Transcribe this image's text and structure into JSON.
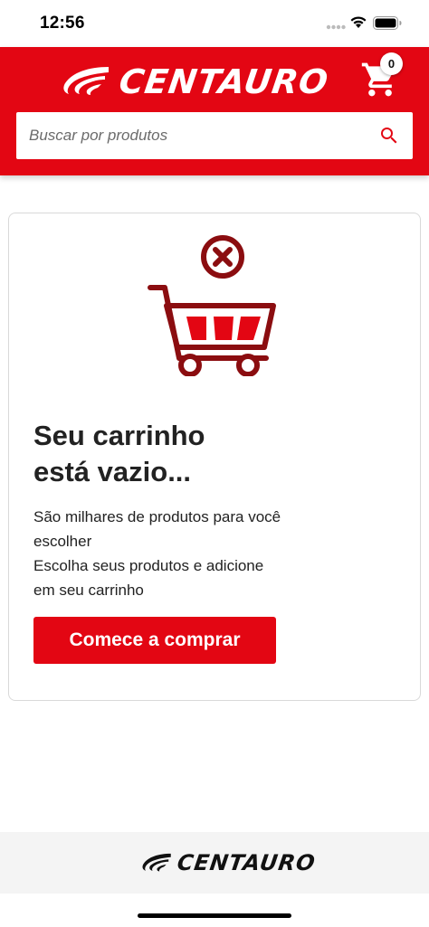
{
  "status_bar": {
    "time": "12:56",
    "icons": [
      "signal-dots-icon",
      "wifi-icon",
      "battery-icon"
    ]
  },
  "header": {
    "brand": "CENTAURO",
    "logo_icon": "centauro-swoosh-icon",
    "cart_icon": "shopping-cart-icon",
    "cart_count": "0",
    "accent_color": "#e30613"
  },
  "search": {
    "placeholder": "Buscar por produtos",
    "value": "",
    "icon": "search-icon"
  },
  "empty_cart": {
    "illustration_icon": "empty-cart-remove-icon",
    "title_line1": "Seu carrinho",
    "title_line2": "está vazio...",
    "message_line1": "São milhares de produtos para você",
    "message_line2": "escolher",
    "message_line3": "Escolha seus produtos e adicione",
    "message_line4": "em seu carrinho",
    "button_label": "Comece a comprar"
  },
  "footer": {
    "brand": "CENTAURO"
  }
}
